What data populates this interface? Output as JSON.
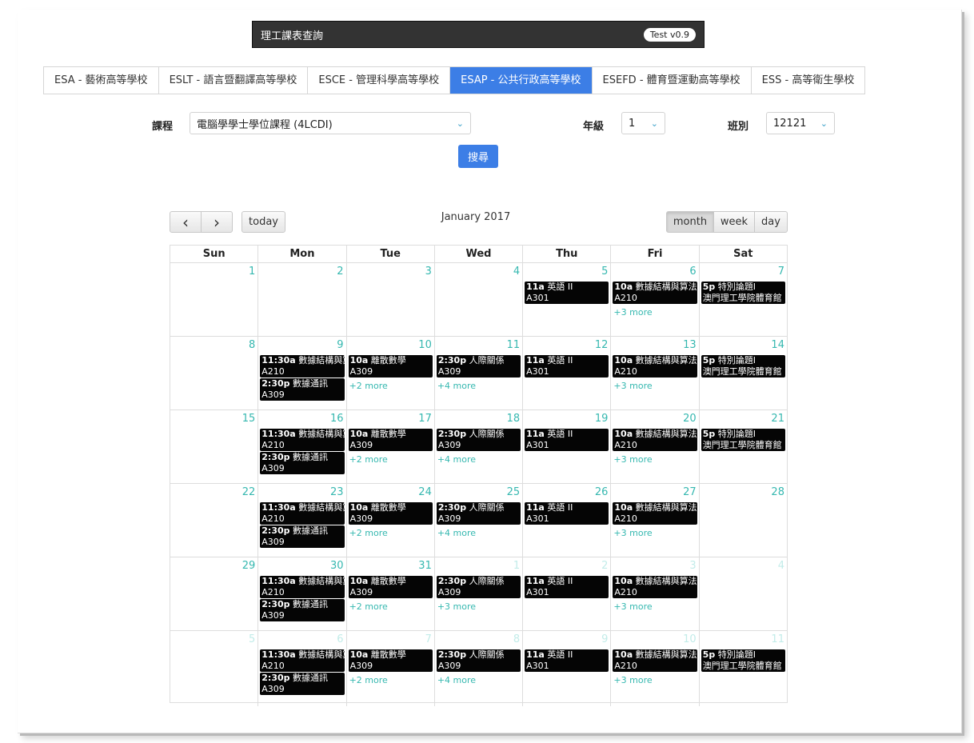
{
  "header": {
    "title": "理工課表查詢",
    "version": "Test v0.9"
  },
  "schools": [
    {
      "label": "ESA - 藝術高等學校",
      "active": false
    },
    {
      "label": "ESLT - 語言暨翻譯高等學校",
      "active": false
    },
    {
      "label": "ESCE - 管理科學高等學校",
      "active": false
    },
    {
      "label": "ESAP - 公共行政高等學校",
      "active": true
    },
    {
      "label": "ESEFD - 體育暨運動高等學校",
      "active": false
    },
    {
      "label": "ESS - 高等衛生學校",
      "active": false
    }
  ],
  "form": {
    "course_label": "課程",
    "course_value": "電腦學學士學位課程 (4LCDI)",
    "year_label": "年級",
    "year_value": "1",
    "class_label": "班別",
    "class_value": "12121",
    "search_label": "搜尋"
  },
  "calendar": {
    "title": "January 2017",
    "today_label": "today",
    "prev_icon": "‹",
    "next_icon": "›",
    "views": [
      {
        "label": "month",
        "active": true
      },
      {
        "label": "week",
        "active": false
      },
      {
        "label": "day",
        "active": false
      }
    ],
    "weekdays": [
      "Sun",
      "Mon",
      "Tue",
      "Wed",
      "Thu",
      "Fri",
      "Sat"
    ],
    "weeks": [
      [
        {
          "d": "1",
          "other": false,
          "events": [],
          "more": ""
        },
        {
          "d": "2",
          "other": false,
          "events": [],
          "more": ""
        },
        {
          "d": "3",
          "other": false,
          "events": [],
          "more": ""
        },
        {
          "d": "4",
          "other": false,
          "events": [],
          "more": ""
        },
        {
          "d": "5",
          "other": false,
          "events": [
            {
              "time": "11a",
              "title": "英語 II",
              "room": "A301"
            }
          ],
          "more": ""
        },
        {
          "d": "6",
          "other": false,
          "events": [
            {
              "time": "10a",
              "title": "數據結構與算法",
              "room": "A210"
            }
          ],
          "more": "+3 more"
        },
        {
          "d": "7",
          "other": false,
          "events": [
            {
              "time": "5p",
              "title": "特別論題I",
              "room": "澳門理工學院體育館"
            }
          ],
          "more": ""
        }
      ],
      [
        {
          "d": "8",
          "other": false,
          "events": [],
          "more": ""
        },
        {
          "d": "9",
          "other": false,
          "events": [
            {
              "time": "11:30a",
              "title": "數據結構與算法",
              "room": "A210"
            },
            {
              "time": "2:30p",
              "title": "數據通訊",
              "room": "A309"
            }
          ],
          "more": ""
        },
        {
          "d": "10",
          "other": false,
          "events": [
            {
              "time": "10a",
              "title": "離散數學",
              "room": "A309"
            }
          ],
          "more": "+2 more"
        },
        {
          "d": "11",
          "other": false,
          "events": [
            {
              "time": "2:30p",
              "title": "人際關係",
              "room": "A309"
            }
          ],
          "more": "+4 more"
        },
        {
          "d": "12",
          "other": false,
          "events": [
            {
              "time": "11a",
              "title": "英語 II",
              "room": "A301"
            }
          ],
          "more": ""
        },
        {
          "d": "13",
          "other": false,
          "events": [
            {
              "time": "10a",
              "title": "數據結構與算法",
              "room": "A210"
            }
          ],
          "more": "+3 more"
        },
        {
          "d": "14",
          "other": false,
          "events": [
            {
              "time": "5p",
              "title": "特別論題I",
              "room": "澳門理工學院體育館"
            }
          ],
          "more": ""
        }
      ],
      [
        {
          "d": "15",
          "other": false,
          "events": [],
          "more": ""
        },
        {
          "d": "16",
          "other": false,
          "events": [
            {
              "time": "11:30a",
              "title": "數據結構與算法",
              "room": "A210"
            },
            {
              "time": "2:30p",
              "title": "數據通訊",
              "room": "A309"
            }
          ],
          "more": ""
        },
        {
          "d": "17",
          "other": false,
          "events": [
            {
              "time": "10a",
              "title": "離散數學",
              "room": "A309"
            }
          ],
          "more": "+2 more"
        },
        {
          "d": "18",
          "other": false,
          "events": [
            {
              "time": "2:30p",
              "title": "人際關係",
              "room": "A309"
            }
          ],
          "more": "+4 more"
        },
        {
          "d": "19",
          "other": false,
          "events": [
            {
              "time": "11a",
              "title": "英語 II",
              "room": "A301"
            }
          ],
          "more": ""
        },
        {
          "d": "20",
          "other": false,
          "events": [
            {
              "time": "10a",
              "title": "數據結構與算法",
              "room": "A210"
            }
          ],
          "more": "+3 more"
        },
        {
          "d": "21",
          "other": false,
          "events": [
            {
              "time": "5p",
              "title": "特別論題I",
              "room": "澳門理工學院體育館"
            }
          ],
          "more": ""
        }
      ],
      [
        {
          "d": "22",
          "other": false,
          "events": [],
          "more": ""
        },
        {
          "d": "23",
          "other": false,
          "events": [
            {
              "time": "11:30a",
              "title": "數據結構與算法",
              "room": "A210"
            },
            {
              "time": "2:30p",
              "title": "數據通訊",
              "room": "A309"
            }
          ],
          "more": ""
        },
        {
          "d": "24",
          "other": false,
          "events": [
            {
              "time": "10a",
              "title": "離散數學",
              "room": "A309"
            }
          ],
          "more": "+2 more"
        },
        {
          "d": "25",
          "other": false,
          "events": [
            {
              "time": "2:30p",
              "title": "人際關係",
              "room": "A309"
            }
          ],
          "more": "+4 more"
        },
        {
          "d": "26",
          "other": false,
          "events": [
            {
              "time": "11a",
              "title": "英語 II",
              "room": "A301"
            }
          ],
          "more": ""
        },
        {
          "d": "27",
          "other": false,
          "events": [
            {
              "time": "10a",
              "title": "數據結構與算法",
              "room": "A210"
            }
          ],
          "more": "+3 more"
        },
        {
          "d": "28",
          "other": false,
          "events": [],
          "more": ""
        }
      ],
      [
        {
          "d": "29",
          "other": false,
          "events": [],
          "more": ""
        },
        {
          "d": "30",
          "other": false,
          "events": [
            {
              "time": "11:30a",
              "title": "數據結構與算法",
              "room": "A210"
            },
            {
              "time": "2:30p",
              "title": "數據通訊",
              "room": "A309"
            }
          ],
          "more": ""
        },
        {
          "d": "31",
          "other": false,
          "events": [
            {
              "time": "10a",
              "title": "離散數學",
              "room": "A309"
            }
          ],
          "more": "+2 more"
        },
        {
          "d": "1",
          "other": true,
          "events": [
            {
              "time": "2:30p",
              "title": "人際關係",
              "room": "A309"
            }
          ],
          "more": "+3 more"
        },
        {
          "d": "2",
          "other": true,
          "events": [
            {
              "time": "11a",
              "title": "英語 II",
              "room": "A301"
            }
          ],
          "more": ""
        },
        {
          "d": "3",
          "other": true,
          "events": [
            {
              "time": "10a",
              "title": "數據結構與算法",
              "room": "A210"
            }
          ],
          "more": "+3 more"
        },
        {
          "d": "4",
          "other": true,
          "events": [],
          "more": ""
        }
      ],
      [
        {
          "d": "5",
          "other": true,
          "events": [],
          "more": ""
        },
        {
          "d": "6",
          "other": true,
          "events": [
            {
              "time": "11:30a",
              "title": "數據結構與算法",
              "room": "A210"
            },
            {
              "time": "2:30p",
              "title": "數據通訊",
              "room": "A309"
            }
          ],
          "more": ""
        },
        {
          "d": "7",
          "other": true,
          "events": [
            {
              "time": "10a",
              "title": "離散數學",
              "room": "A309"
            }
          ],
          "more": "+2 more"
        },
        {
          "d": "8",
          "other": true,
          "events": [
            {
              "time": "2:30p",
              "title": "人際關係",
              "room": "A309"
            }
          ],
          "more": "+4 more"
        },
        {
          "d": "9",
          "other": true,
          "events": [
            {
              "time": "11a",
              "title": "英語 II",
              "room": "A301"
            }
          ],
          "more": ""
        },
        {
          "d": "10",
          "other": true,
          "events": [
            {
              "time": "10a",
              "title": "數據結構與算法",
              "room": "A210"
            }
          ],
          "more": "+3 more"
        },
        {
          "d": "11",
          "other": true,
          "events": [
            {
              "time": "5p",
              "title": "特別論題I",
              "room": "澳門理工學院體育館"
            }
          ],
          "more": ""
        }
      ]
    ]
  },
  "colors": {
    "accent": "#3c7ee6",
    "day_number": "#36b8b0",
    "event_bg": "#050505",
    "header_bar": "#333333"
  }
}
